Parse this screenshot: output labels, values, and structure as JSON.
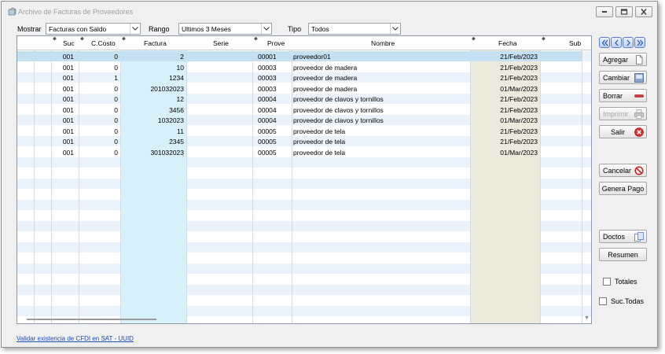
{
  "window": {
    "title": "Archivo de Facturas de Proveedores"
  },
  "filters": {
    "mostrar_label": "Mostrar",
    "mostrar_value": "Facturas con Saldo",
    "rango_label": "Rango",
    "rango_value": "Ultimos 3 Meses",
    "tipo_label": "Tipo",
    "tipo_value": "Todos"
  },
  "table": {
    "headers": {
      "suc": "Suc",
      "ccosto": "C.Costo",
      "factura": "Factura",
      "serie": "Serie",
      "prove": "Prove",
      "nombre": "Nombre",
      "fecha": "Fecha",
      "sub": "Sub"
    },
    "rows": [
      {
        "suc": "001",
        "ccosto": "0",
        "factura": "2",
        "serie": "",
        "prove": "00001",
        "nombre": "proveedor01",
        "fecha": "21/Feb/2023"
      },
      {
        "suc": "001",
        "ccosto": "0",
        "factura": "10",
        "serie": "",
        "prove": "00003",
        "nombre": "proveedor de madera",
        "fecha": "21/Feb/2023"
      },
      {
        "suc": "001",
        "ccosto": "1",
        "factura": "1234",
        "serie": "",
        "prove": "00003",
        "nombre": "proveedor de madera",
        "fecha": "21/Feb/2023"
      },
      {
        "suc": "001",
        "ccosto": "0",
        "factura": "201032023",
        "serie": "",
        "prove": "00003",
        "nombre": "proveedor de madera",
        "fecha": "01/Mar/2023"
      },
      {
        "suc": "001",
        "ccosto": "0",
        "factura": "12",
        "serie": "",
        "prove": "00004",
        "nombre": "proveedor de clavos y tornillos",
        "fecha": "21/Feb/2023"
      },
      {
        "suc": "001",
        "ccosto": "0",
        "factura": "3456",
        "serie": "",
        "prove": "00004",
        "nombre": "proveedor de clavos y tornillos",
        "fecha": "21/Feb/2023"
      },
      {
        "suc": "001",
        "ccosto": "0",
        "factura": "1032023",
        "serie": "",
        "prove": "00004",
        "nombre": "proveedor de clavos y tornillos",
        "fecha": "01/Mar/2023"
      },
      {
        "suc": "001",
        "ccosto": "0",
        "factura": "11",
        "serie": "",
        "prove": "00005",
        "nombre": "proveedor de tela",
        "fecha": "21/Feb/2023"
      },
      {
        "suc": "001",
        "ccosto": "0",
        "factura": "2345",
        "serie": "",
        "prove": "00005",
        "nombre": "proveedor de tela",
        "fecha": "21/Feb/2023"
      },
      {
        "suc": "001",
        "ccosto": "0",
        "factura": "301032023",
        "serie": "",
        "prove": "00005",
        "nombre": "proveedor de tela",
        "fecha": "01/Mar/2023"
      }
    ]
  },
  "sidebar": {
    "agregar": "Agregar",
    "cambiar": "Cambiar",
    "borrar": "Borrar",
    "imprimir": "Imprimir",
    "salir": "Salir",
    "cancelar": "Cancelar",
    "genera_pago": "Genera Pago",
    "doctos": "Doctos",
    "resumen": "Resumen",
    "totales": "Totales",
    "suc_todas": "Suc.Todas"
  },
  "footer": {
    "link": "Validar existencia de CFDI en SAT - UUID"
  },
  "colors": {
    "factura_col": "#d8f0fa",
    "fecha_col": "#ece9dd",
    "stripe": "#eaf3fb",
    "selected": "#c5dff3"
  }
}
